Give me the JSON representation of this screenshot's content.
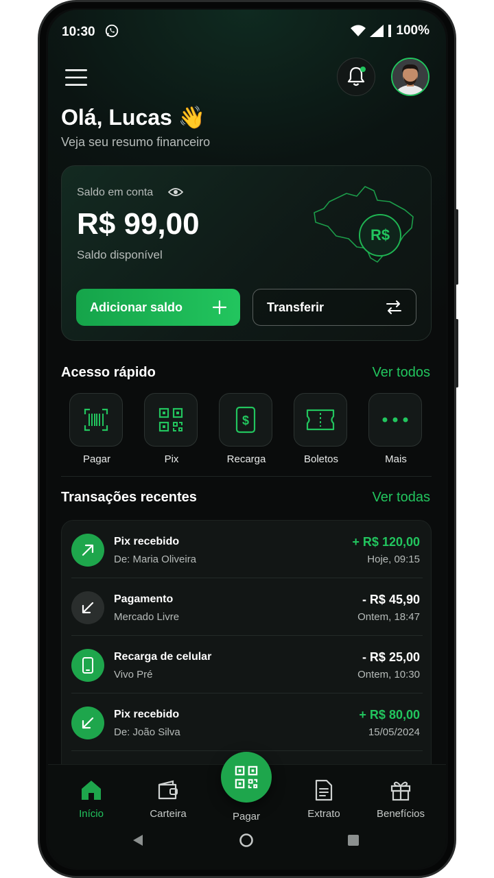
{
  "status": {
    "time": "10:30",
    "battery": "100%"
  },
  "header": {
    "greeting": "Olá, Lucas 👋",
    "subtitle": "Veja seu resumo financeiro"
  },
  "balance_card": {
    "label": "Saldo em conta",
    "amount": "R$ 99,00",
    "caption": "Saldo disponível",
    "badge": "R$",
    "add_button": "Adicionar saldo",
    "transfer_button": "Transferir"
  },
  "quick_access": {
    "title": "Acesso rápido",
    "see_all": "Ver todos",
    "items": [
      {
        "label": "Pagar",
        "icon": "barcode-icon"
      },
      {
        "label": "Pix",
        "icon": "qr-code-icon"
      },
      {
        "label": "Recarga",
        "icon": "phone-dollar-icon"
      },
      {
        "label": "Boletos",
        "icon": "ticket-icon"
      },
      {
        "label": "Mais",
        "icon": "more-dots-icon"
      }
    ]
  },
  "transactions": {
    "title": "Transações recentes",
    "see_all": "Ver todas",
    "items": [
      {
        "title": "Pix recebido",
        "sub": "De: Maria Oliveira",
        "amount": "+ R$ 120,00",
        "date": "Hoje, 09:15",
        "type": "in"
      },
      {
        "title": "Pagamento",
        "sub": "Mercado Livre",
        "amount": "- R$ 45,90",
        "date": "Ontem, 18:47",
        "type": "out"
      },
      {
        "title": "Recarga de celular",
        "sub": "Vivo Pré",
        "amount": "- R$ 25,00",
        "date": "Ontem, 10:30",
        "type": "phone"
      },
      {
        "title": "Pix recebido",
        "sub": "De: João Silva",
        "amount": "+ R$ 80,00",
        "date": "15/05/2024",
        "type": "in2"
      }
    ]
  },
  "bottom_nav": {
    "items": [
      {
        "label": "Início",
        "active": true
      },
      {
        "label": "Carteira",
        "active": false
      },
      {
        "label": "Pagar",
        "active": false
      },
      {
        "label": "Extrato",
        "active": false
      },
      {
        "label": "Benefícios",
        "active": false
      }
    ]
  },
  "colors": {
    "accent": "#22c55e",
    "background": "#0a0c0c",
    "card": "#121615"
  }
}
